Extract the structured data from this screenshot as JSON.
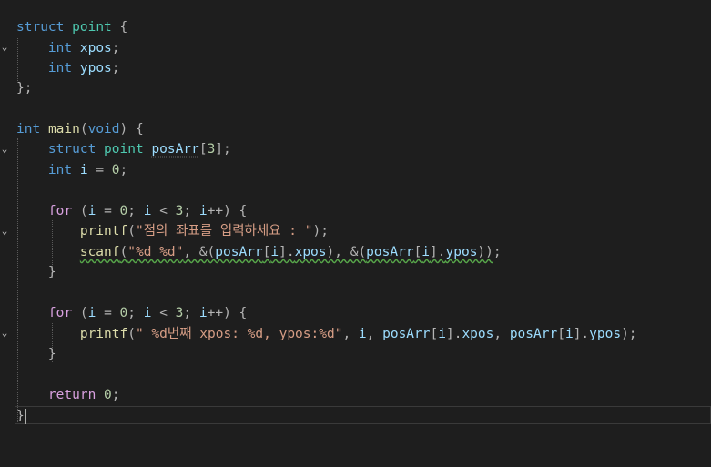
{
  "editor": {
    "language": "C",
    "lines": [
      "struct point {",
      "int xpos;",
      "int ypos;",
      "};",
      "",
      "int main(void) {",
      "struct point posArr[3];",
      "int i = 0;",
      "",
      "for (i = 0; i < 3; i++) {",
      "printf(\"점의 좌표를 입력하세요 : \");",
      "scanf(\"%d %d\", &(posArr[i].xpos), &(posArr[i].ypos));",
      "}",
      "",
      "for (i = 0; i < 3; i++) {",
      "printf(\" %d번째 xpos: %d, ypos:%d\", i, posArr[i].xpos, posArr[i].ypos);",
      "}",
      "",
      "return 0;",
      "}"
    ]
  },
  "colors": {
    "background": "#1e1e1e",
    "keyword": "#569cd6",
    "type": "#4ec9b0",
    "function": "#dcdcaa",
    "variable": "#9cdcfe",
    "number": "#b5cea8",
    "string": "#d69d85",
    "control": "#d8a0df",
    "warning_squiggle": "#57a64a"
  },
  "icons": {
    "fold_expanded": "chevron-down-icon"
  }
}
